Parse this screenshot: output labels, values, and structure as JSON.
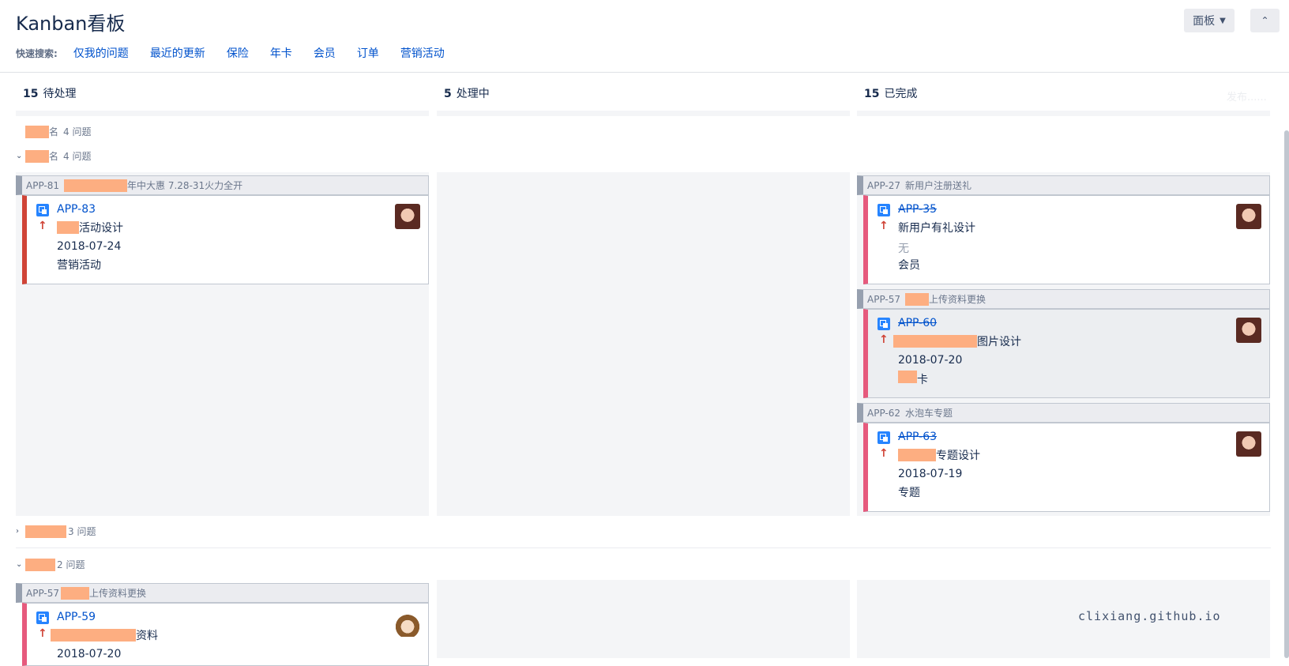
{
  "header": {
    "title": "Kanban看板",
    "board_button": "面板",
    "collapse_button": "⌃"
  },
  "quick_filters": {
    "label": "快速搜索:",
    "items": [
      "仅我的问题",
      "最近的更新",
      "保险",
      "年卡",
      "会员",
      "订单",
      "营销活动"
    ]
  },
  "columns": [
    {
      "count": "15",
      "name": "待处理"
    },
    {
      "count": "5",
      "name": "处理中"
    },
    {
      "count": "15",
      "name": "已完成"
    }
  ],
  "release_label": "发布......",
  "swimlanes": [
    {
      "name": "名",
      "count": "4 问题"
    },
    {
      "name": "名",
      "count": "4 问题"
    },
    {
      "name": "",
      "count": "3 问题"
    },
    {
      "name": "",
      "count": "2 问题"
    }
  ],
  "cards": {
    "c1": {
      "parent_key": "APP-81",
      "parent_summary": "年中大惠 7.28-31火力全开",
      "key": "APP-83",
      "summary": "活动设计",
      "field1": "2018-07-24",
      "field2": "营销活动"
    },
    "c2": {
      "parent_key": "APP-27",
      "parent_summary": "新用户注册送礼",
      "key": "APP-35",
      "summary": "新用户有礼设计",
      "field1": "无",
      "field2": "会员"
    },
    "c3": {
      "parent_key": "APP-57",
      "parent_summary": "上传资料更换",
      "key": "APP-60",
      "summary": "图片设计",
      "field1": "2018-07-20",
      "field2": "卡"
    },
    "c4": {
      "parent_key": "APP-62",
      "parent_summary": "水泡车专题",
      "key": "APP-63",
      "summary": "专题设计",
      "field1": "2018-07-19",
      "field2": "专题"
    },
    "c5": {
      "parent_key": "APP-57",
      "parent_summary": "上传资料更换",
      "key": "APP-59",
      "summary": "资料",
      "field1": "2018-07-20"
    }
  },
  "watermark": "clixiang.github.io",
  "colors": {
    "accent": "#0052cc",
    "priority_high": "#d04437",
    "card_edge_pink": "#e65a7d",
    "redaction": "#fdae81"
  }
}
